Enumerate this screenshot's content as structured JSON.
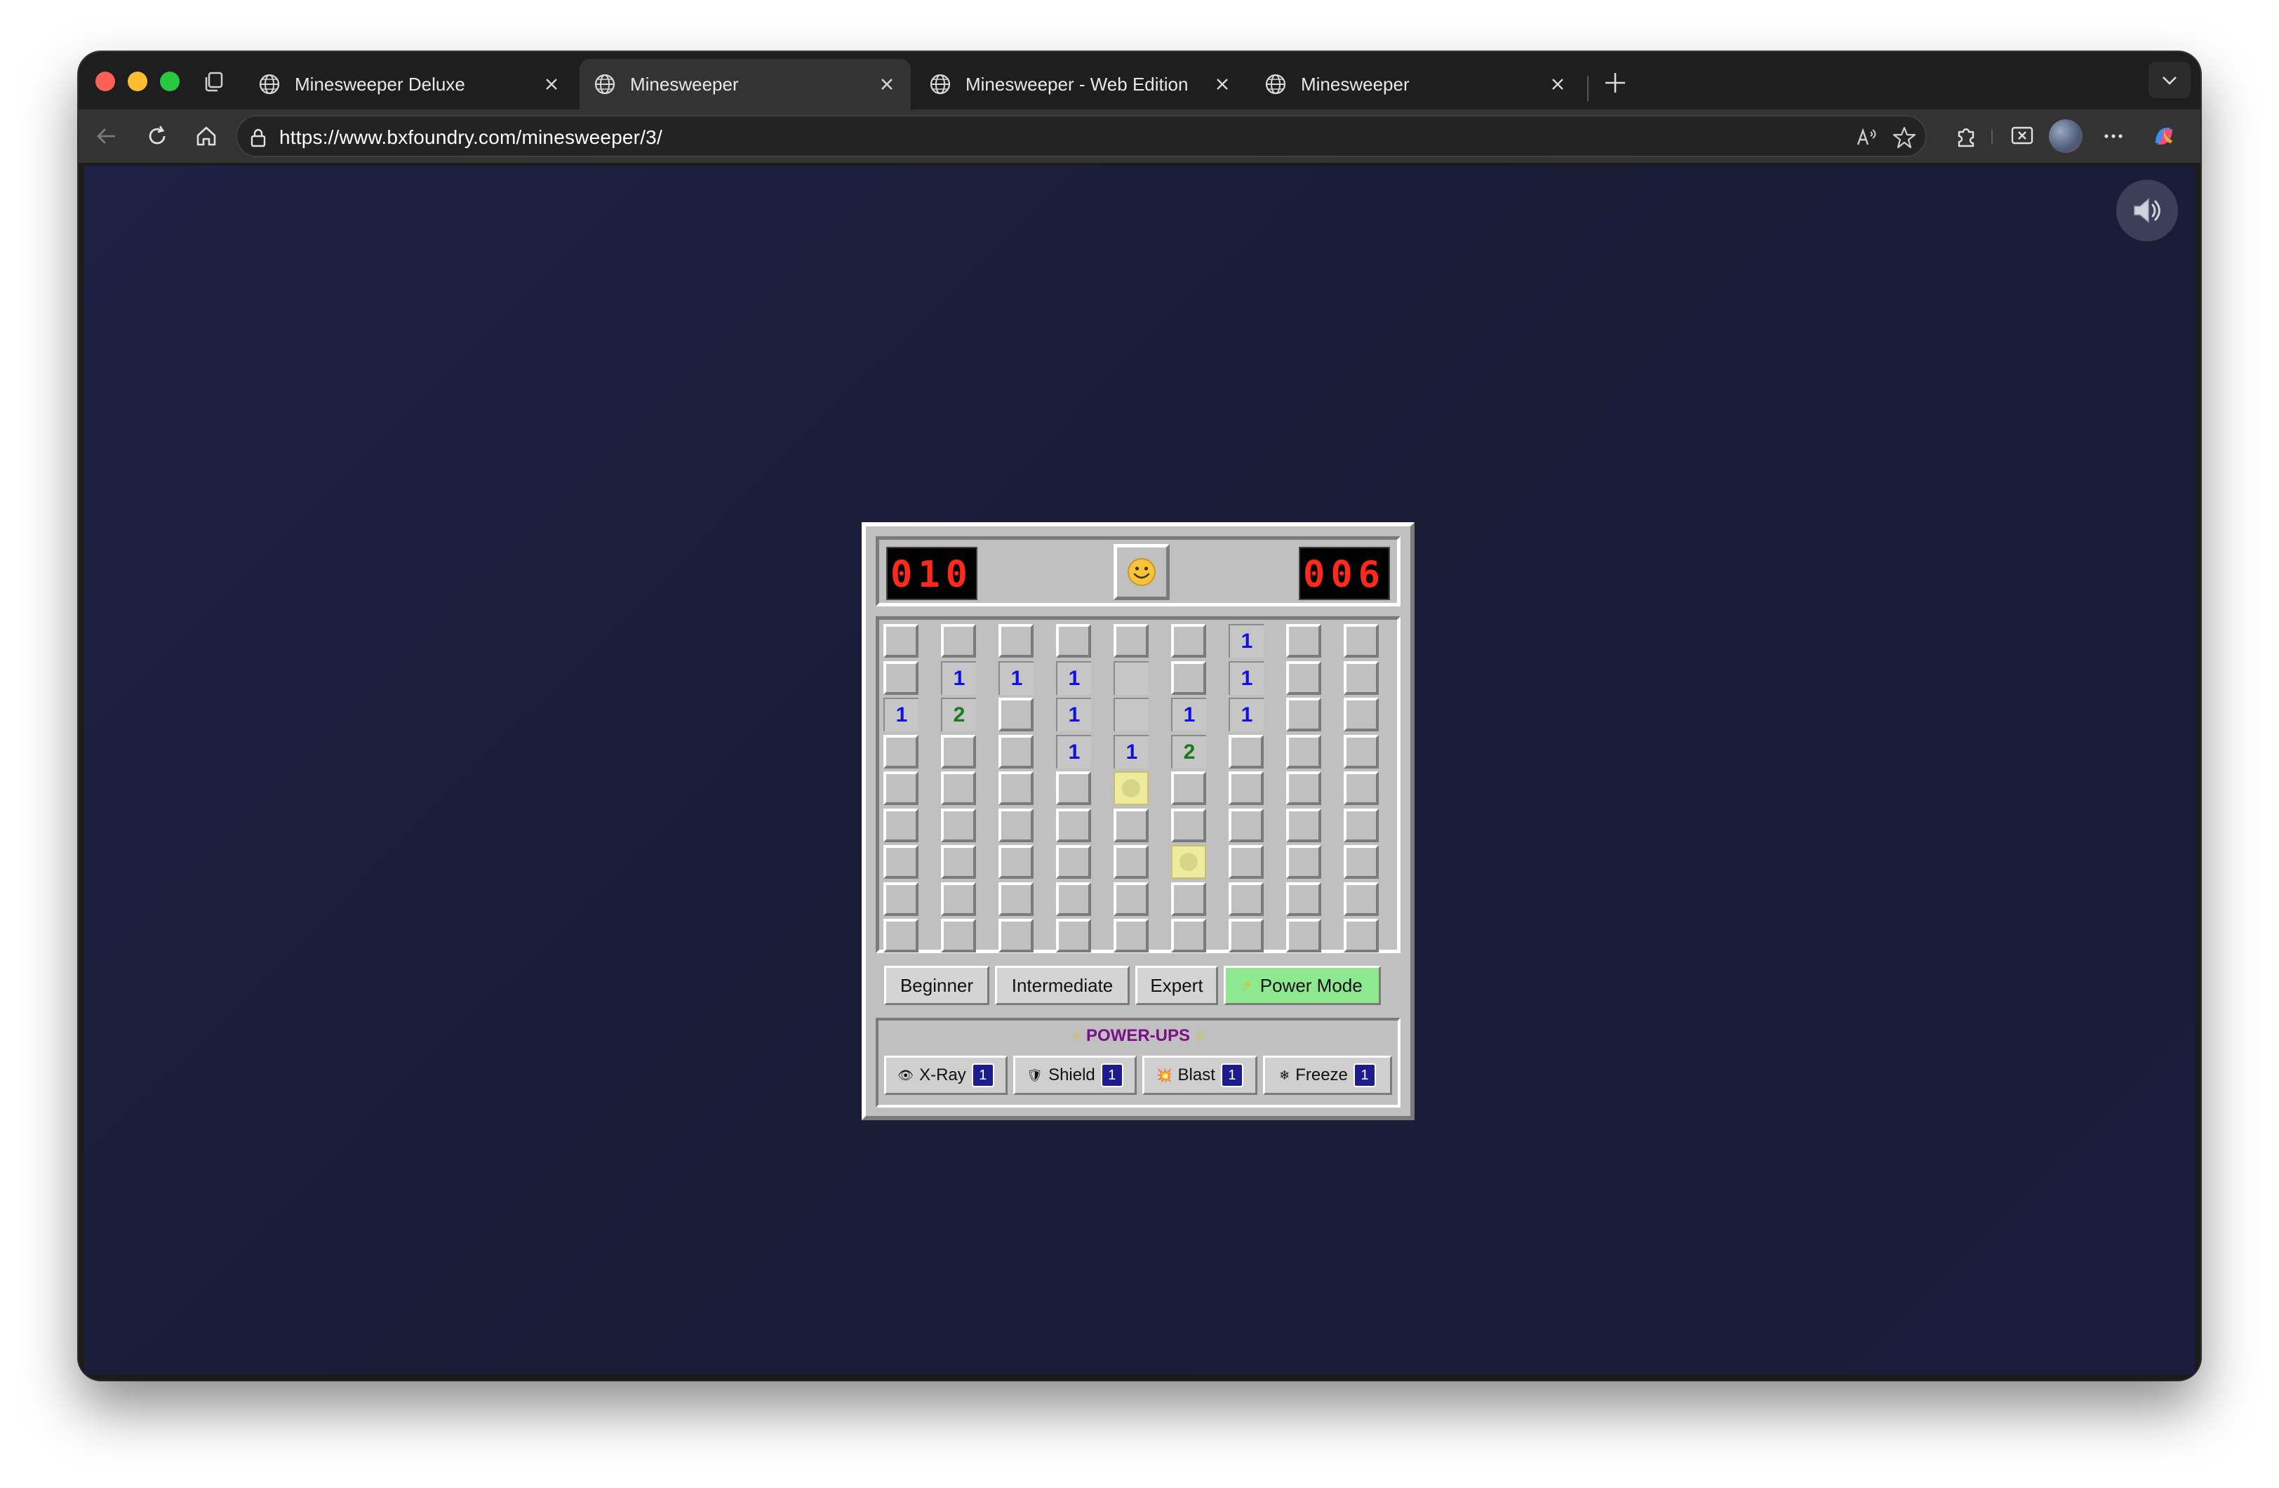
{
  "browser": {
    "tabs": [
      {
        "title": "Minesweeper Deluxe",
        "active": false
      },
      {
        "title": "Minesweeper",
        "active": true
      },
      {
        "title": "Minesweeper - Web Edition",
        "active": false
      },
      {
        "title": "Minesweeper",
        "active": false
      }
    ],
    "url": "https://www.bxfoundry.com/minesweeper/3/",
    "colors": {
      "chrome": "#1e1e1e",
      "toolbar": "#333333",
      "page_bg": "#1b1e3a"
    }
  },
  "game": {
    "mine_counter": "010",
    "timer": "006",
    "face": "🙂",
    "board": {
      "columns": 9,
      "rows": 9,
      "grid": [
        [
          "H",
          "H",
          "H",
          "H",
          "H",
          "H",
          "1",
          "H",
          "H"
        ],
        [
          "H",
          "1",
          "1",
          "1",
          "R",
          "H",
          "1",
          "H",
          "H"
        ],
        [
          "1",
          "2",
          "H",
          "1",
          "R",
          "1",
          "1",
          "H",
          "H"
        ],
        [
          "H",
          "H",
          "H",
          "1",
          "1",
          "2",
          "H",
          "H",
          "H"
        ],
        [
          "H",
          "H",
          "H",
          "H",
          "Y",
          "H",
          "H",
          "H",
          "H"
        ],
        [
          "H",
          "H",
          "H",
          "H",
          "H",
          "H",
          "H",
          "H",
          "H"
        ],
        [
          "H",
          "H",
          "H",
          "H",
          "H",
          "Y",
          "H",
          "H",
          "H"
        ],
        [
          "H",
          "H",
          "H",
          "H",
          "H",
          "H",
          "H",
          "H",
          "H"
        ],
        [
          "H",
          "H",
          "H",
          "H",
          "H",
          "H",
          "H",
          "H",
          "H"
        ]
      ],
      "colors": {
        "1": "#1010e0",
        "2": "#1b7a1b",
        "highlight": "#eeec9c"
      }
    },
    "difficulty": {
      "beginner": "Beginner",
      "intermediate": "Intermediate",
      "expert": "Expert",
      "power_mode": "Power Mode"
    },
    "powerups": {
      "title": "POWER-UPS",
      "items": [
        {
          "label": "X-Ray",
          "icon": "eye-icon",
          "count": "1"
        },
        {
          "label": "Shield",
          "icon": "shield-icon",
          "count": "1"
        },
        {
          "label": "Blast",
          "icon": "explosion-icon",
          "count": "1"
        },
        {
          "label": "Freeze",
          "icon": "snowflake-icon",
          "count": "1"
        }
      ]
    }
  }
}
